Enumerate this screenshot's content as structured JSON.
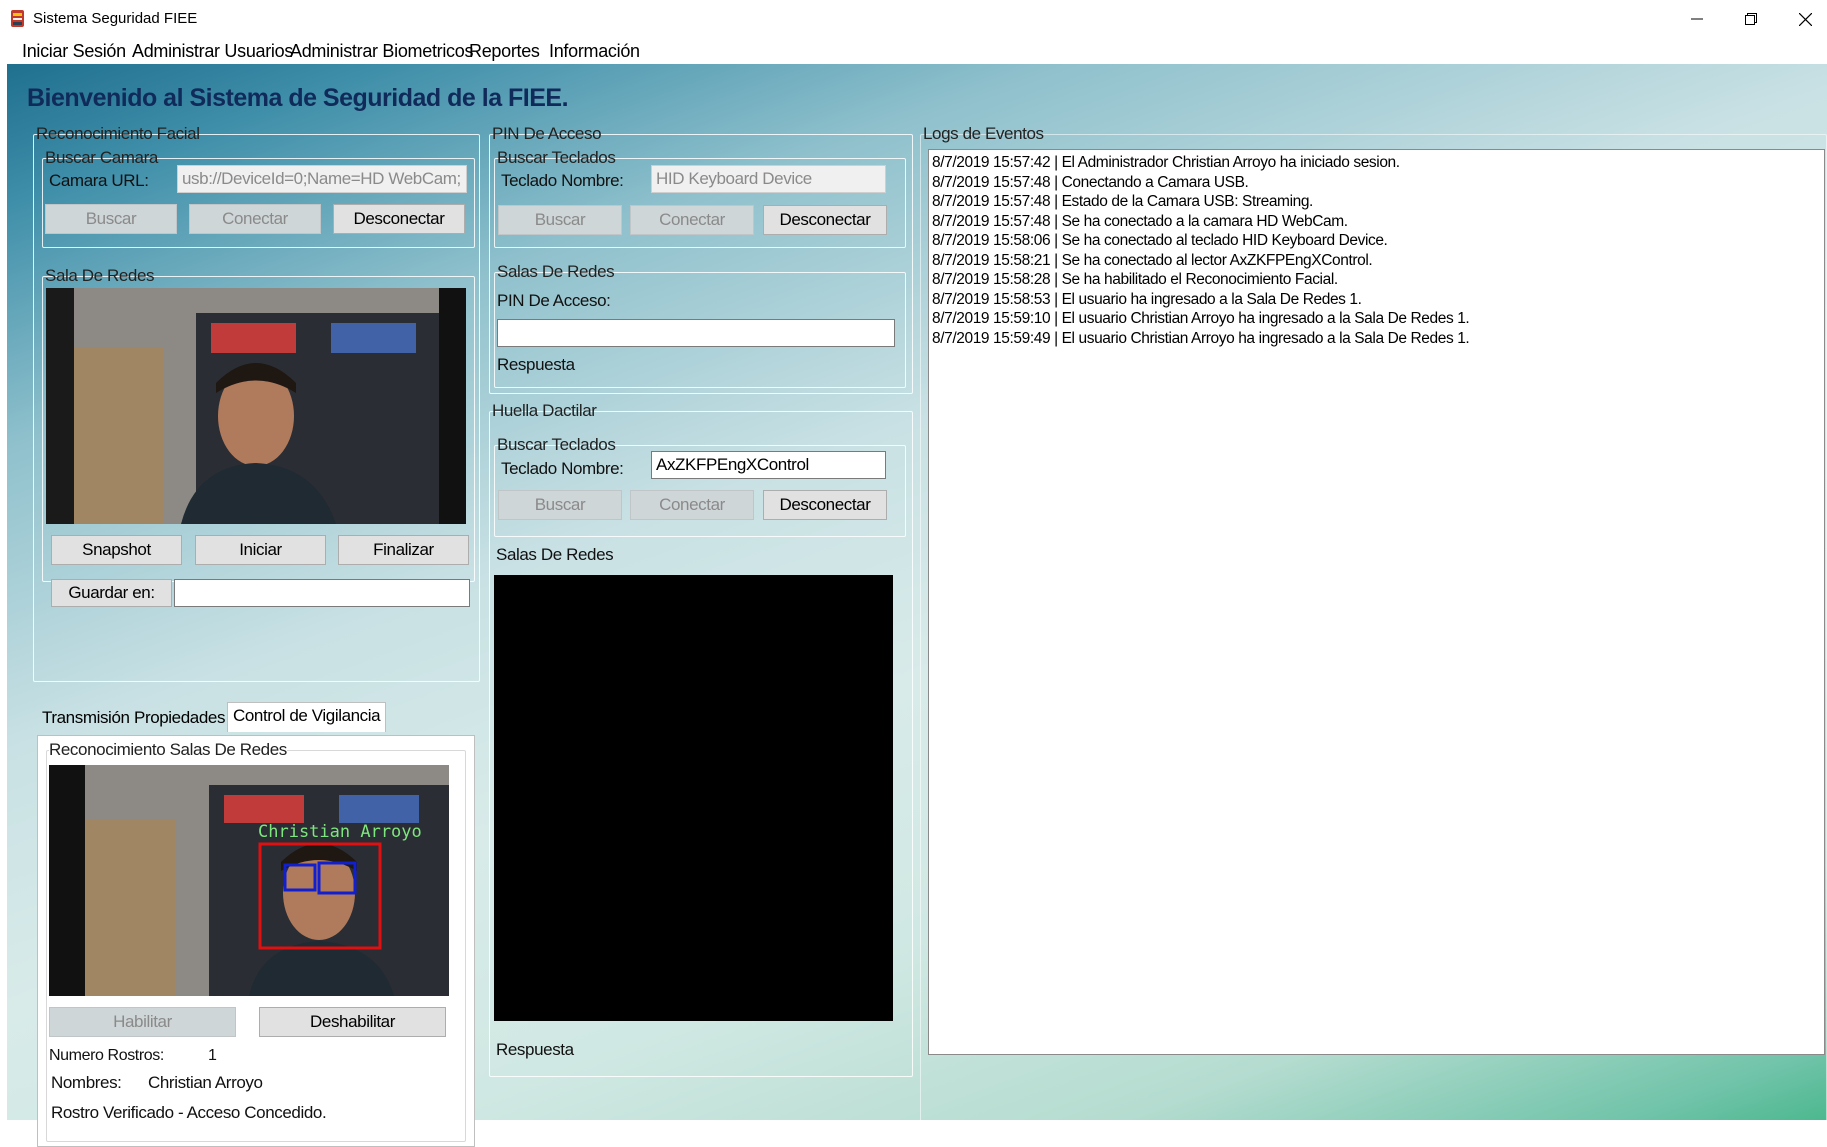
{
  "window": {
    "title": "Sistema Seguridad FIEE"
  },
  "menu": {
    "items": [
      "Iniciar Sesión",
      "Administrar Usuarios",
      "Administrar Biometricos",
      "Reportes",
      "Información"
    ]
  },
  "heading": "Bienvenido al Sistema de Seguridad de la FIEE.",
  "facial": {
    "group_label": "Reconocimiento Facial",
    "buscar_camara": {
      "label": "Buscar Camara",
      "url_label": "Camara URL:",
      "url_value": "usb://DeviceId=0;Name=HD WebCam;",
      "buscar": "Buscar",
      "conectar": "Conectar",
      "desconectar": "Desconectar"
    },
    "sala": {
      "label": "Sala De Redes",
      "snapshot": "Snapshot",
      "iniciar": "Iniciar",
      "finalizar": "Finalizar",
      "guardar": "Guardar en:",
      "guardar_value": ""
    },
    "tabs": [
      "Transmisión",
      "Propiedades",
      "Control de Vigilancia"
    ],
    "vigilancia": {
      "label": "Reconocimiento Salas De Redes",
      "overlay_name": "Christian Arroyo",
      "habilitar": "Habilitar",
      "deshabilitar": "Deshabilitar",
      "num_rostros_label": "Numero Rostros:",
      "num_rostros_value": "1",
      "nombres_label": "Nombres:",
      "nombres_value": "Christian Arroyo",
      "status": "Rostro Verificado - Acceso Concedido."
    }
  },
  "pin": {
    "group_label": "PIN De Acceso",
    "buscar_teclados": {
      "label": "Buscar Teclados",
      "name_label": "Teclado Nombre:",
      "name_value": "HID Keyboard Device",
      "buscar": "Buscar",
      "conectar": "Conectar",
      "desconectar": "Desconectar"
    },
    "salas": {
      "label": "Salas De Redes",
      "pin_label": "PIN De Acceso:",
      "pin_value": "",
      "respuesta": "Respuesta"
    }
  },
  "huella": {
    "group_label": "Huella Dactilar",
    "buscar_teclados": {
      "label": "Buscar Teclados",
      "name_label": "Teclado Nombre:",
      "name_value": "AxZKFPEngXControl",
      "buscar": "Buscar",
      "conectar": "Conectar",
      "desconectar": "Desconectar"
    },
    "salas_label": "Salas De Redes",
    "respuesta": "Respuesta"
  },
  "logs": {
    "label": "Logs de Eventos",
    "lines": [
      "8/7/2019 15:57:42 | El Administrador Christian Arroyo ha iniciado sesion.",
      "8/7/2019 15:57:48 | Conectando a Camara USB.",
      "8/7/2019 15:57:48 | Estado de la Camara USB: Streaming.",
      "8/7/2019 15:57:48 | Se ha conectado a la camara HD WebCam.",
      "8/7/2019 15:58:06 | Se ha conectado al teclado HID Keyboard Device.",
      "8/7/2019 15:58:21 | Se ha conectado al lector AxZKFPEngXControl.",
      "8/7/2019 15:58:28 | Se ha habilitado el Reconocimiento Facial.",
      "8/7/2019 15:58:53 | El usuario    ha ingresado a la Sala De Redes 1.",
      "8/7/2019 15:59:10 | El usuario Christian Arroyo  ha ingresado a la Sala De Redes 1.",
      "8/7/2019 15:59:49 | El usuario Christian Arroyo  ha ingresado a la Sala De Redes 1."
    ]
  }
}
